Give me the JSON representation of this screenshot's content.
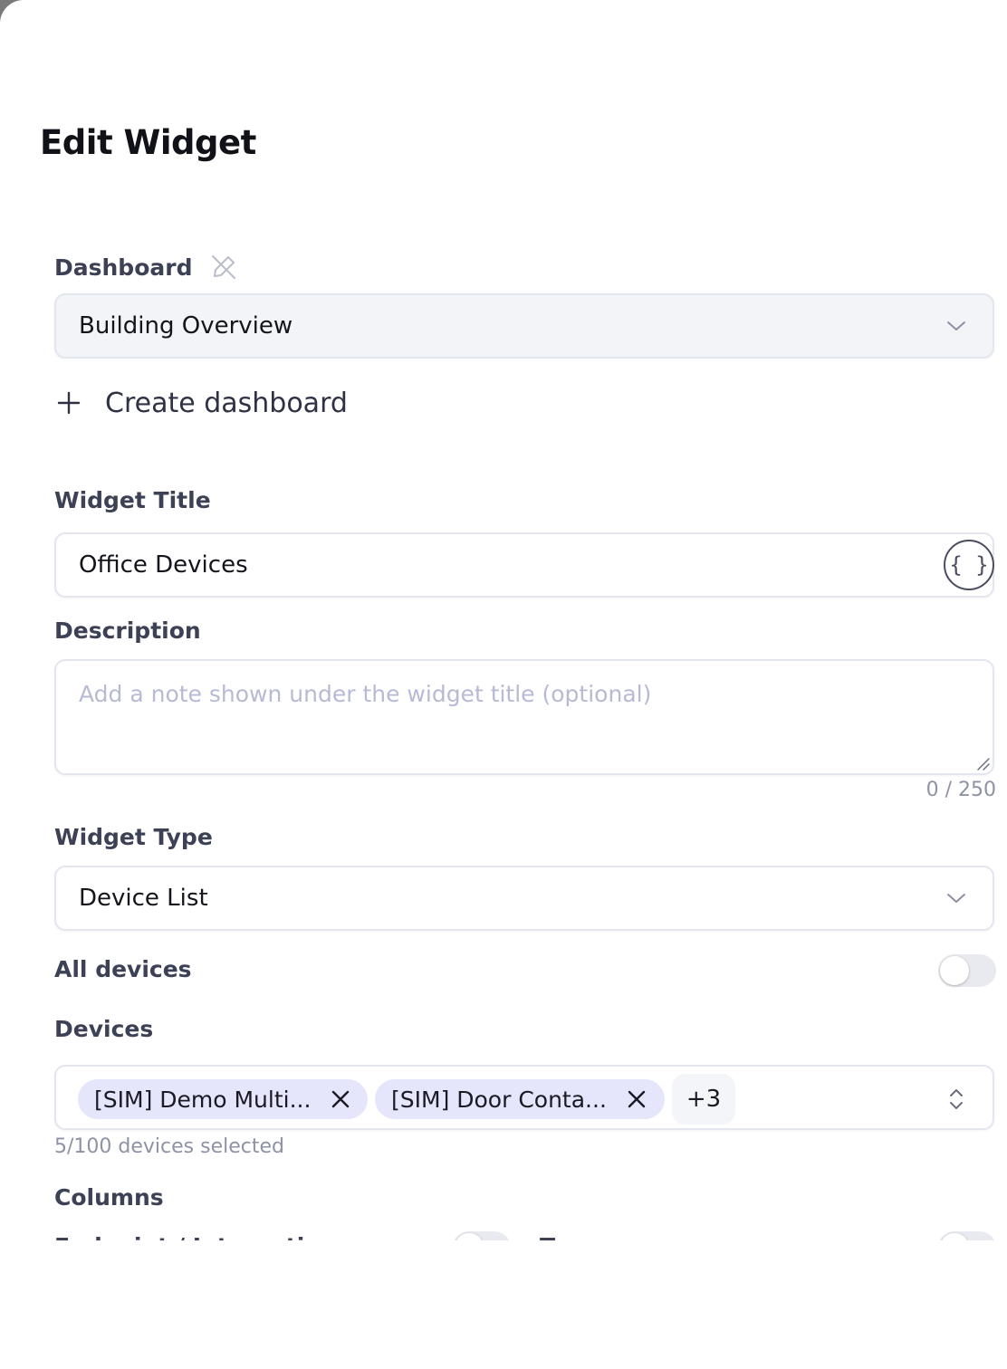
{
  "dialog": {
    "title": "Edit Widget"
  },
  "dashboard": {
    "label": "Dashboard",
    "selected": "Building Overview",
    "create_label": "Create dashboard"
  },
  "widget_title": {
    "label": "Widget Title",
    "value": "Office Devices",
    "variable_button": "{ }"
  },
  "description": {
    "label": "Description",
    "placeholder": "Add a note shown under the widget title (optional)",
    "counter": "0 / 250"
  },
  "widget_type": {
    "label": "Widget Type",
    "selected": "Device List"
  },
  "all_devices": {
    "label": "All devices",
    "enabled": false
  },
  "devices": {
    "label": "Devices",
    "chips": [
      "[SIM] Demo Multi...",
      "[SIM] Door Conta..."
    ],
    "more_count": "+3",
    "helper": "5/100 devices selected"
  },
  "columns": {
    "label": "Columns",
    "items": [
      "Endpoint / Integration",
      "Type"
    ]
  }
}
